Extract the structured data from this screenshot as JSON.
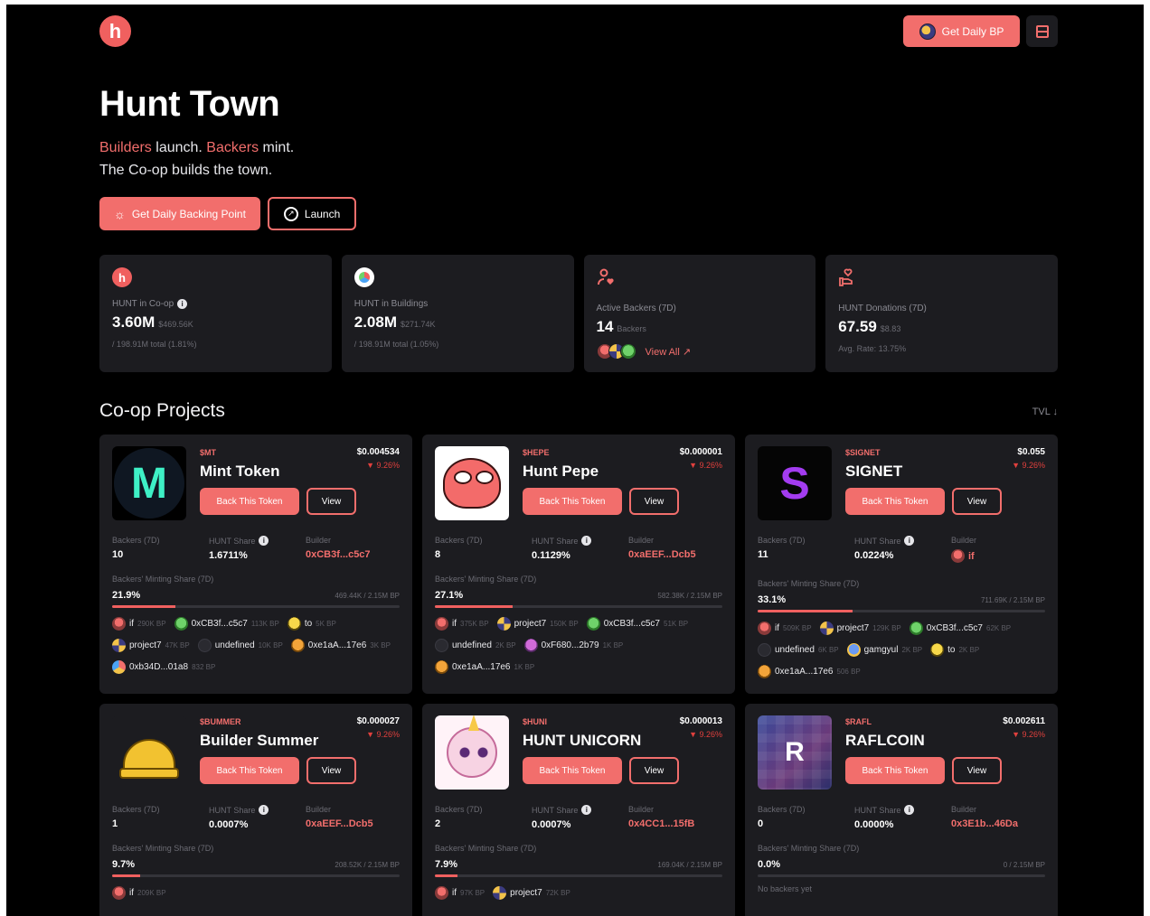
{
  "header": {
    "logo_letter": "h",
    "bp_button_label": "Get Daily BP"
  },
  "hero": {
    "title": "Hunt Town",
    "tagline_builders": "Builders",
    "tagline_launch": " launch. ",
    "tagline_backers": "Backers",
    "tagline_mint": " mint.",
    "tagline_line2": "The Co-op builds the town.",
    "primary_button": "Get Daily Backing Point",
    "secondary_button": "Launch"
  },
  "stats": [
    {
      "label": "HUNT in Co-op",
      "value": "3.60M",
      "sub": "$469.56K",
      "foot": "/ 198.91M total (1.81%)"
    },
    {
      "label": "HUNT in Buildings",
      "value": "2.08M",
      "sub": "$271.74K",
      "foot": "/ 198.91M total (1.05%)"
    },
    {
      "label": "Active Backers (7D)",
      "value": "14",
      "sub": "Backers",
      "link": "View All ↗"
    },
    {
      "label": "HUNT Donations (7D)",
      "value": "67.59",
      "sub": "$8.83",
      "foot": "Avg. Rate: 13.75%"
    }
  ],
  "section": {
    "title": "Co-op Projects",
    "sort": "TVL ↓"
  },
  "labels": {
    "back_button": "Back This Token",
    "view_button": "View",
    "backers": "Backers (7D)",
    "hunt_share": "HUNT Share",
    "builder": "Builder",
    "minting_share": "Backers' Minting Share (7D)"
  },
  "projects": [
    {
      "ticker": "$MT",
      "name": "Mint Token",
      "price": "$0.004534",
      "change": "▼ 9.26%",
      "backers": "10",
      "hunt_share": "1.6711%",
      "builder": "0xCB3f...c5c7",
      "mint_pct": "21.9%",
      "mint_fill": 0.219,
      "mint_total": "469.44K / 2.15M BP",
      "backer_list": [
        {
          "name": "if",
          "bp": "290K BP",
          "av": "if"
        },
        {
          "name": "0xCB3f...c5c7",
          "bp": "113K BP",
          "av": "frog"
        },
        {
          "name": "to",
          "bp": "5K BP",
          "av": "yellow"
        },
        {
          "name": "project7",
          "bp": "47K BP",
          "av": "cube"
        },
        {
          "name": "undefined",
          "bp": "10K BP",
          "av": "dark"
        },
        {
          "name": "0xe1aA...17e6",
          "bp": "3K BP",
          "av": "orange"
        },
        {
          "name": "0xb34D...01a8",
          "bp": "832 BP",
          "av": "multi"
        }
      ]
    },
    {
      "ticker": "$HEPE",
      "name": "Hunt Pepe",
      "price": "$0.000001",
      "change": "▼ 9.26%",
      "backers": "8",
      "hunt_share": "0.1129%",
      "builder": "0xaEEF...Dcb5",
      "mint_pct": "27.1%",
      "mint_fill": 0.271,
      "mint_total": "582.38K / 2.15M BP",
      "backer_list": [
        {
          "name": "if",
          "bp": "375K BP",
          "av": "if"
        },
        {
          "name": "project7",
          "bp": "150K BP",
          "av": "cube"
        },
        {
          "name": "0xCB3f...c5c7",
          "bp": "51K BP",
          "av": "frog"
        },
        {
          "name": "undefined",
          "bp": "2K BP",
          "av": "dark"
        },
        {
          "name": "0xF680...2b79",
          "bp": "1K BP",
          "av": "pink"
        },
        {
          "name": "0xe1aA...17e6",
          "bp": "1K BP",
          "av": "orange"
        }
      ]
    },
    {
      "ticker": "$SIGNET",
      "name": "SIGNET",
      "price": "$0.055",
      "change": "▼ 9.26%",
      "backers": "11",
      "hunt_share": "0.0224%",
      "builder": "if",
      "mint_pct": "33.1%",
      "mint_fill": 0.331,
      "mint_total": "711.69K / 2.15M BP",
      "backer_list": [
        {
          "name": "if",
          "bp": "509K BP",
          "av": "if"
        },
        {
          "name": "project7",
          "bp": "129K BP",
          "av": "cube"
        },
        {
          "name": "0xCB3f...c5c7",
          "bp": "62K BP",
          "av": "frog"
        },
        {
          "name": "undefined",
          "bp": "6K BP",
          "av": "dark"
        },
        {
          "name": "gamgyul",
          "bp": "2K BP",
          "av": "blue"
        },
        {
          "name": "to",
          "bp": "2K BP",
          "av": "yellow"
        },
        {
          "name": "0xe1aA...17e6",
          "bp": "506 BP",
          "av": "orange"
        }
      ]
    },
    {
      "ticker": "$BUMMER",
      "name": "Builder Summer",
      "price": "$0.000027",
      "change": "▼ 9.26%",
      "backers": "1",
      "hunt_share": "0.0007%",
      "builder": "0xaEEF...Dcb5",
      "mint_pct": "9.7%",
      "mint_fill": 0.097,
      "mint_total": "208.52K / 2.15M BP",
      "backer_list": [
        {
          "name": "if",
          "bp": "209K BP",
          "av": "if"
        }
      ]
    },
    {
      "ticker": "$HUNI",
      "name": "HUNT UNICORN",
      "price": "$0.000013",
      "change": "▼ 9.26%",
      "backers": "2",
      "hunt_share": "0.0007%",
      "builder": "0x4CC1...15fB",
      "mint_pct": "7.9%",
      "mint_fill": 0.079,
      "mint_total": "169.04K / 2.15M BP",
      "backer_list": [
        {
          "name": "if",
          "bp": "97K BP",
          "av": "if"
        },
        {
          "name": "project7",
          "bp": "72K BP",
          "av": "cube"
        }
      ]
    },
    {
      "ticker": "$RAFL",
      "name": "RAFLCOIN",
      "price": "$0.002611",
      "change": "▼ 9.26%",
      "backers": "0",
      "hunt_share": "0.0000%",
      "builder": "0x3E1b...46Da",
      "mint_pct": "0.0%",
      "mint_fill": 0.0,
      "mint_total": "0 / 2.15M BP",
      "thumb_letter": "R",
      "no_backers": "No backers yet",
      "backer_list": []
    }
  ]
}
